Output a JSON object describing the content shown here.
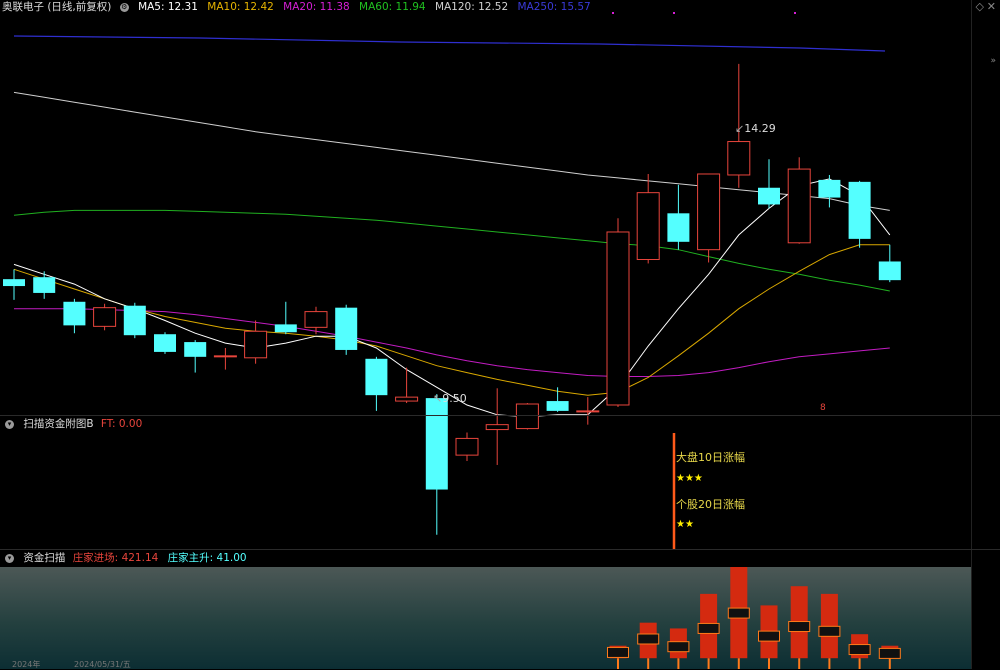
{
  "main_panel": {
    "stock_name": "奥联电子 (日线,前复权)",
    "indicators": [
      {
        "label": "MA5: 12.31",
        "color": "#ffffff"
      },
      {
        "label": "MA10: 12.42",
        "color": "#e6b400"
      },
      {
        "label": "MA20: 11.38",
        "color": "#d61fd6"
      },
      {
        "label": "MA60: 11.94",
        "color": "#20c020"
      },
      {
        "label": "MA120: 12.52",
        "color": "#d0d0d0"
      },
      {
        "label": "MA250: 15.57",
        "color": "#2f2fd0"
      }
    ],
    "high_label": "14.29",
    "low_label": "9.50",
    "marker_label": "8"
  },
  "sub_panel_1": {
    "title": "扫描资金附图B",
    "value": "FT: 0.00",
    "annotations": [
      {
        "text": "大盘10日涨幅",
        "color": "#e8d84a"
      },
      {
        "text": "★★★",
        "color": "#ffee00"
      },
      {
        "text": "个股20日涨幅",
        "color": "#e8d84a"
      },
      {
        "text": "★★",
        "color": "#ffee00"
      }
    ]
  },
  "sub_panel_2": {
    "title": "资金扫描",
    "value1": "庄家进场: 421.14",
    "value2": "庄家主升: 41.00"
  },
  "date_axis": {
    "labels": [
      "2024年",
      "2024/05/31/五"
    ]
  },
  "colors": {
    "up": "#e8453c",
    "down": "#54ffff",
    "background": "#000000"
  },
  "candles": [
    {
      "o": 12.1,
      "c": 12.03,
      "h": 12.2,
      "l": 11.89
    },
    {
      "o": 12.12,
      "c": 11.96,
      "h": 12.18,
      "l": 11.9
    },
    {
      "o": 11.87,
      "c": 11.63,
      "h": 11.9,
      "l": 11.55
    },
    {
      "o": 11.62,
      "c": 11.81,
      "h": 11.85,
      "l": 11.58
    },
    {
      "o": 11.83,
      "c": 11.53,
      "h": 11.86,
      "l": 11.5
    },
    {
      "o": 11.54,
      "c": 11.36,
      "h": 11.56,
      "l": 11.34
    },
    {
      "o": 11.46,
      "c": 11.31,
      "h": 11.48,
      "l": 11.15
    },
    {
      "o": 11.32,
      "c": 11.32,
      "h": 11.4,
      "l": 11.18
    },
    {
      "o": 11.3,
      "c": 11.57,
      "h": 11.68,
      "l": 11.24
    },
    {
      "o": 11.64,
      "c": 11.56,
      "h": 11.87,
      "l": 11.54
    },
    {
      "o": 11.61,
      "c": 11.77,
      "h": 11.82,
      "l": 11.54
    },
    {
      "o": 11.81,
      "c": 11.38,
      "h": 11.84,
      "l": 11.33
    },
    {
      "o": 11.29,
      "c": 10.92,
      "h": 11.31,
      "l": 10.76
    },
    {
      "o": 10.86,
      "c": 10.9,
      "h": 11.2,
      "l": 10.84
    },
    {
      "o": 10.89,
      "c": 9.96,
      "h": 10.93,
      "l": 9.5
    },
    {
      "o": 10.31,
      "c": 10.48,
      "h": 10.54,
      "l": 10.25
    },
    {
      "o": 10.57,
      "c": 10.62,
      "h": 10.99,
      "l": 10.21
    },
    {
      "o": 10.58,
      "c": 10.83,
      "h": 10.84,
      "l": 10.57
    },
    {
      "o": 10.86,
      "c": 10.76,
      "h": 11.0,
      "l": 10.75
    },
    {
      "o": 10.76,
      "c": 10.76,
      "h": 10.9,
      "l": 10.62
    },
    {
      "o": 10.82,
      "c": 12.58,
      "h": 12.72,
      "l": 10.8
    },
    {
      "o": 12.3,
      "c": 12.98,
      "h": 13.17,
      "l": 12.26
    },
    {
      "o": 12.77,
      "c": 12.48,
      "h": 13.06,
      "l": 12.4
    },
    {
      "o": 12.4,
      "c": 13.17,
      "h": 13.17,
      "l": 12.27
    },
    {
      "o": 13.16,
      "c": 13.5,
      "h": 14.29,
      "l": 13.03
    },
    {
      "o": 13.03,
      "c": 12.86,
      "h": 13.32,
      "l": 12.82
    },
    {
      "o": 12.47,
      "c": 13.22,
      "h": 13.34,
      "l": 12.46
    },
    {
      "o": 13.11,
      "c": 12.93,
      "h": 13.16,
      "l": 12.83
    },
    {
      "o": 13.09,
      "c": 12.51,
      "h": 13.1,
      "l": 12.42
    },
    {
      "o": 12.28,
      "c": 12.09,
      "h": 12.45,
      "l": 12.07
    }
  ],
  "ma_series": {
    "ma5": [
      12.25,
      12.15,
      12.05,
      11.9,
      11.8,
      11.68,
      11.55,
      11.45,
      11.4,
      11.45,
      11.52,
      11.52,
      11.4,
      11.18,
      11.0,
      10.82,
      10.72,
      10.7,
      10.72,
      10.72,
      11.0,
      11.42,
      11.8,
      12.15,
      12.55,
      12.82,
      13.05,
      13.12,
      12.95,
      12.55
    ],
    "ma10": [
      12.2,
      12.1,
      12.0,
      11.9,
      11.8,
      11.72,
      11.66,
      11.6,
      11.57,
      11.55,
      11.52,
      11.48,
      11.42,
      11.32,
      11.22,
      11.15,
      11.08,
      11.02,
      10.96,
      10.92,
      10.95,
      11.1,
      11.32,
      11.55,
      11.8,
      12.0,
      12.18,
      12.35,
      12.45,
      12.45
    ],
    "ma20": [
      11.8,
      11.8,
      11.8,
      11.79,
      11.78,
      11.77,
      11.74,
      11.7,
      11.66,
      11.62,
      11.57,
      11.52,
      11.46,
      11.4,
      11.33,
      11.27,
      11.22,
      11.18,
      11.15,
      11.12,
      11.11,
      11.11,
      11.12,
      11.15,
      11.2,
      11.26,
      11.31,
      11.34,
      11.37,
      11.4
    ],
    "ma60": [
      12.75,
      12.78,
      12.8,
      12.8,
      12.8,
      12.8,
      12.79,
      12.78,
      12.77,
      12.76,
      12.74,
      12.72,
      12.7,
      12.67,
      12.64,
      12.61,
      12.58,
      12.55,
      12.52,
      12.49,
      12.46,
      12.44,
      12.4,
      12.33,
      12.26,
      12.2,
      12.15,
      12.09,
      12.04,
      11.98
    ],
    "ma120": [
      14.0,
      13.95,
      13.9,
      13.85,
      13.8,
      13.75,
      13.7,
      13.65,
      13.6,
      13.56,
      13.52,
      13.48,
      13.44,
      13.4,
      13.36,
      13.32,
      13.28,
      13.24,
      13.2,
      13.16,
      13.13,
      13.1,
      13.07,
      13.04,
      13.01,
      12.98,
      12.95,
      12.92,
      12.85,
      12.8
    ]
  },
  "fund_bars": [
    {
      "i": 20,
      "top": 0.18,
      "bot": 0.05,
      "mid": 0.11
    },
    {
      "i": 21,
      "top": 0.42,
      "bot": 0.05,
      "mid": 0.25
    },
    {
      "i": 22,
      "top": 0.36,
      "bot": 0.05,
      "mid": 0.17
    },
    {
      "i": 23,
      "top": 0.72,
      "bot": 0.05,
      "mid": 0.36
    },
    {
      "i": 24,
      "top": 1.0,
      "bot": 0.05,
      "mid": 0.52
    },
    {
      "i": 25,
      "top": 0.6,
      "bot": 0.05,
      "mid": 0.28
    },
    {
      "i": 26,
      "top": 0.8,
      "bot": 0.05,
      "mid": 0.38
    },
    {
      "i": 27,
      "top": 0.72,
      "bot": 0.05,
      "mid": 0.33
    },
    {
      "i": 28,
      "top": 0.3,
      "bot": 0.05,
      "mid": 0.14
    },
    {
      "i": 29,
      "top": 0.18,
      "bot": 0.05,
      "mid": 0.1
    }
  ]
}
